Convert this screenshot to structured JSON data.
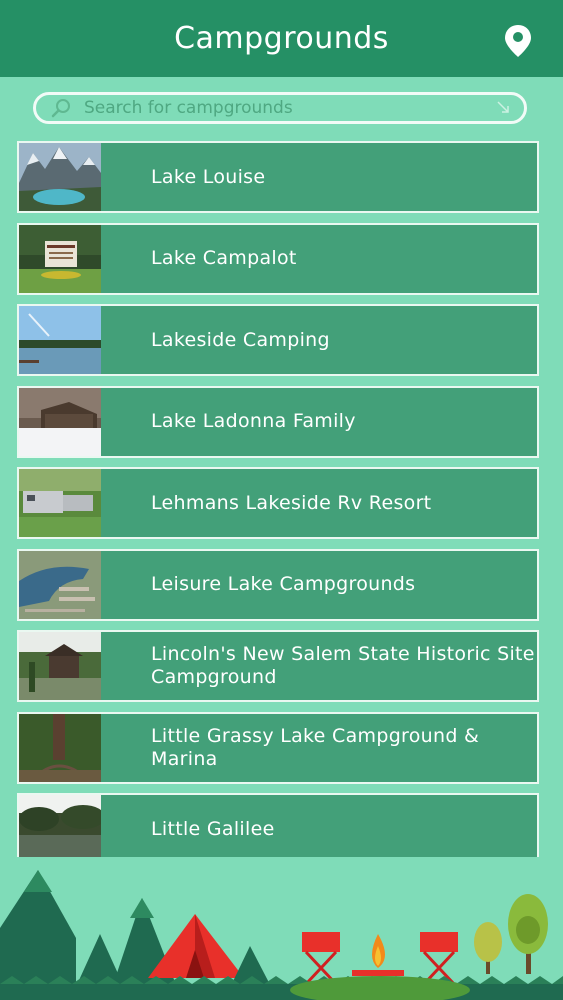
{
  "header": {
    "title": "Campgrounds"
  },
  "search": {
    "placeholder": "Search for campgrounds"
  },
  "campgrounds": [
    {
      "label": "Lake Louise",
      "thumb": "mountain-lake-photo"
    },
    {
      "label": "Lake Campalot",
      "thumb": "campground-sign-photo"
    },
    {
      "label": "Lakeside Camping",
      "thumb": "lake-sky-photo"
    },
    {
      "label": "Lake Ladonna Family",
      "thumb": "snowy-cabin-photo"
    },
    {
      "label": "Lehmans Lakeside Rv Resort",
      "thumb": "rv-park-photo"
    },
    {
      "label": "Leisure Lake Campgrounds",
      "thumb": "aerial-lake-photo"
    },
    {
      "label": "Lincoln's New Salem State Historic Site Campground",
      "thumb": "historic-cabin-photo"
    },
    {
      "label": "Little Grassy Lake Campground & Marina",
      "thumb": "forest-tree-photo"
    },
    {
      "label": "Little Galilee",
      "thumb": "river-trees-photo"
    }
  ],
  "colors": {
    "header": "#259065",
    "background": "#7fdcb8",
    "row": "#43a079",
    "row_border": "#eaf8f1"
  },
  "icons": {
    "location": "map-pin-icon",
    "search": "search-icon"
  }
}
